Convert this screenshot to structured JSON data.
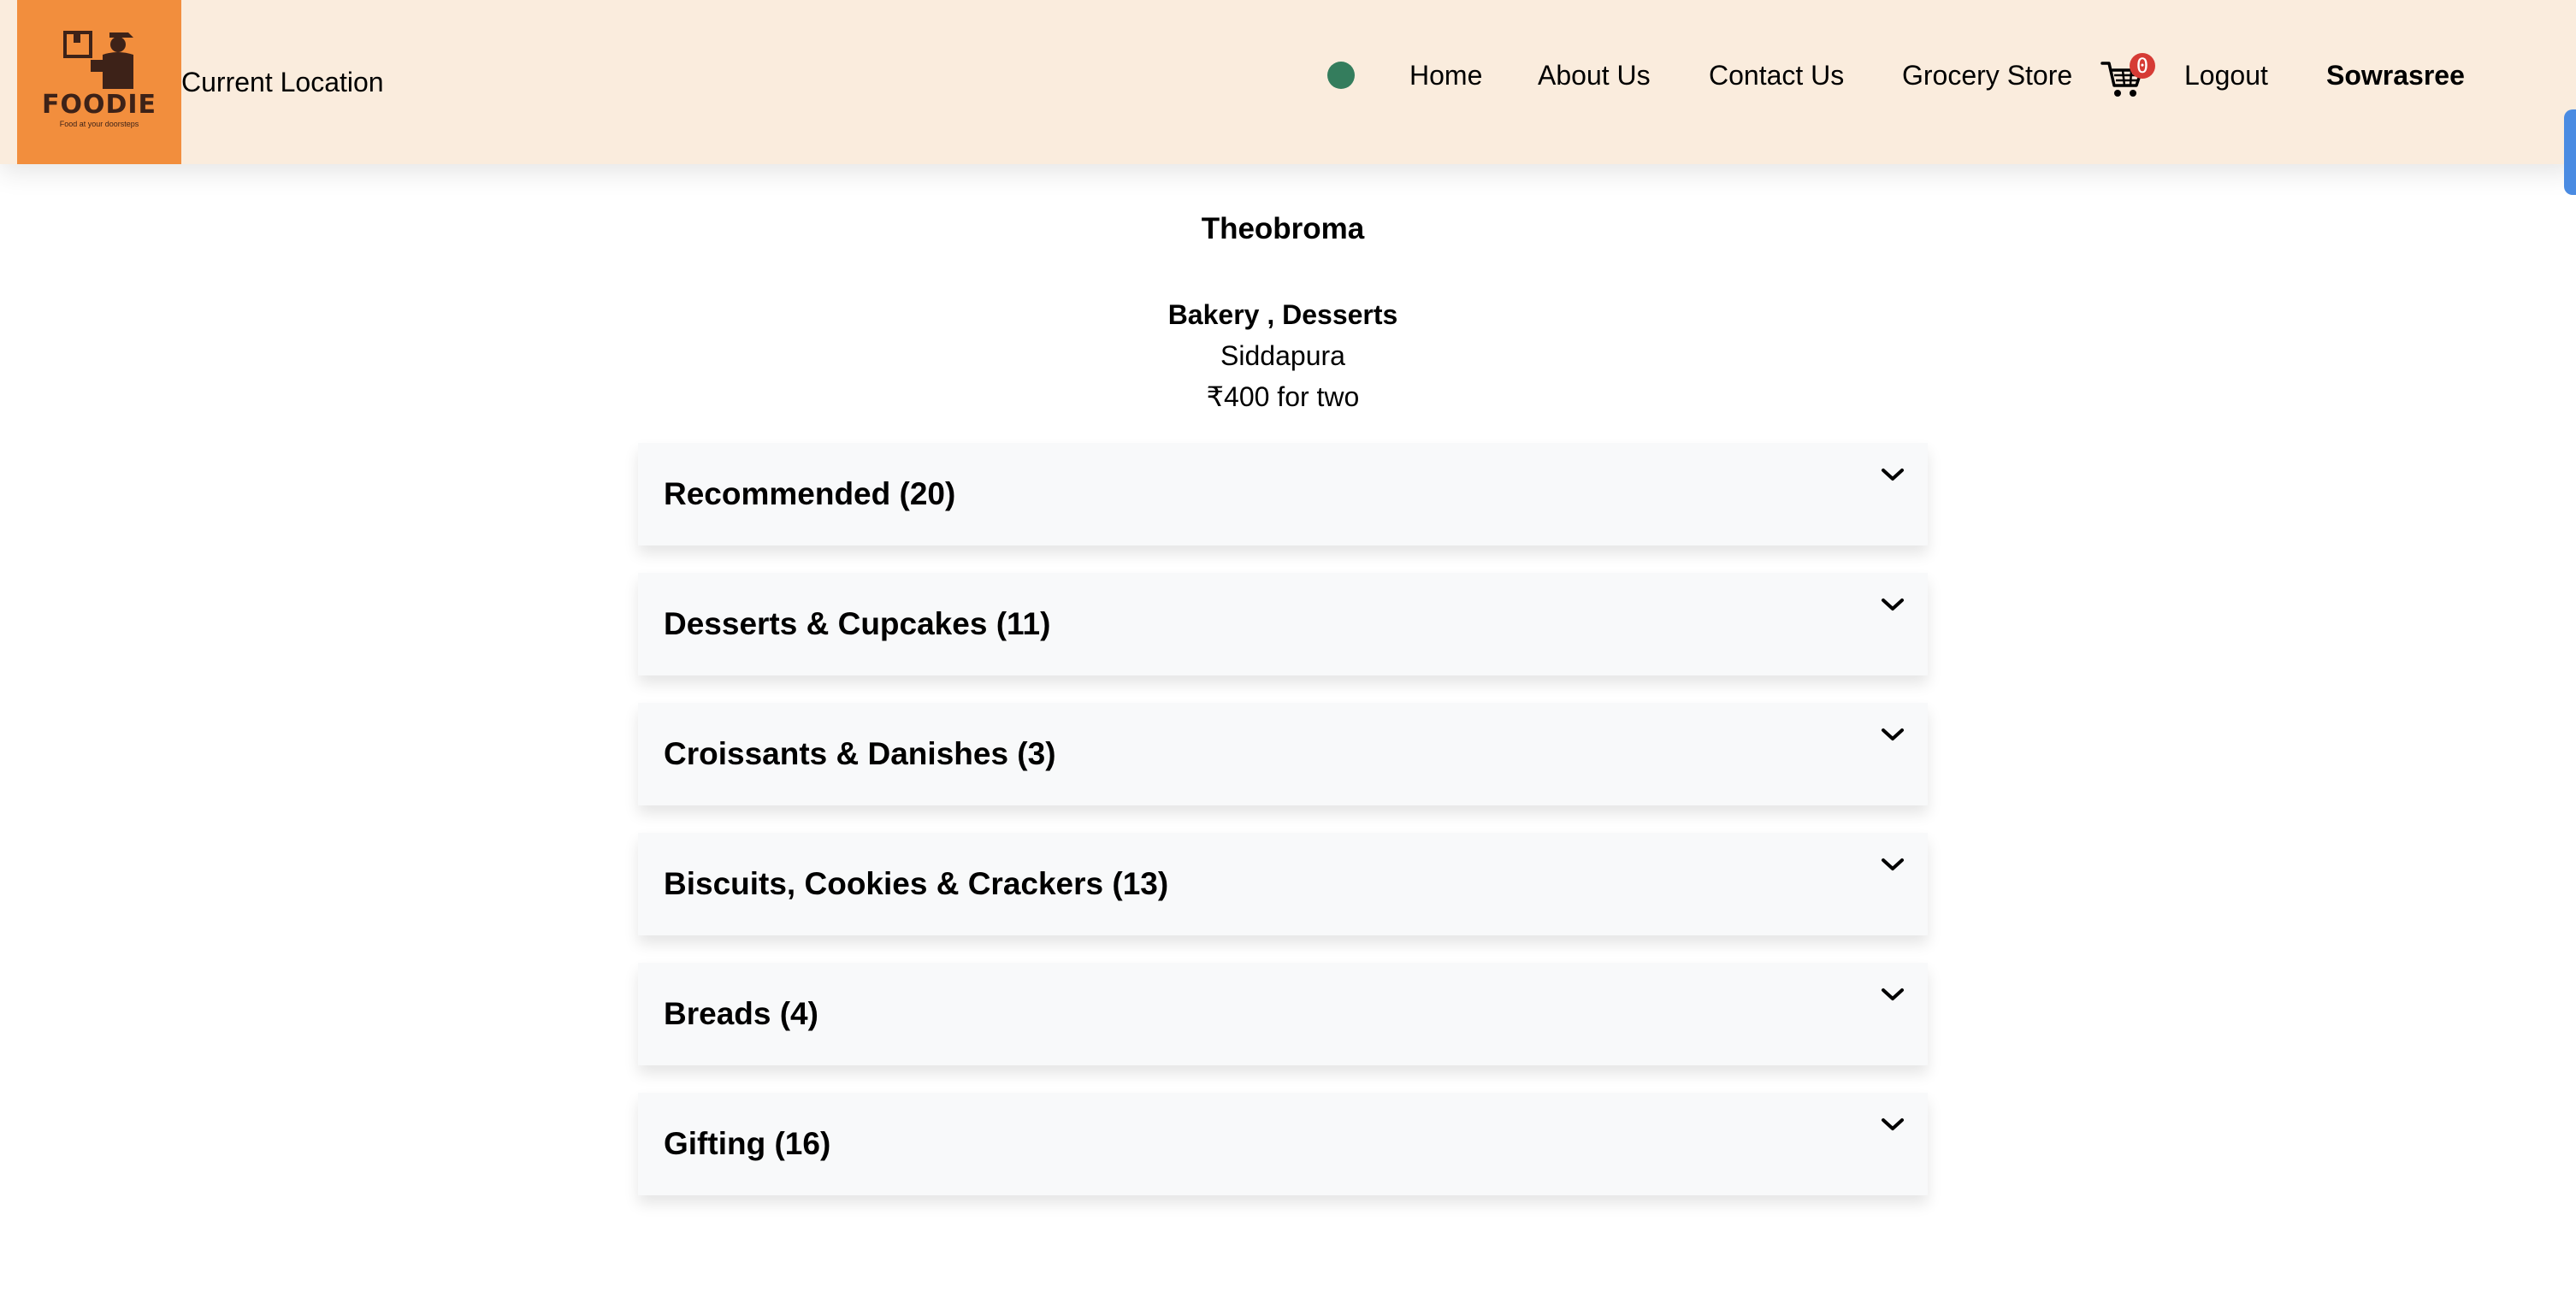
{
  "header": {
    "logo_word": "FOODIE",
    "logo_tagline": "Food at your doorsteps",
    "location_label": "Current Location",
    "nav": {
      "home": "Home",
      "about": "About Us",
      "contact": "Contact Us",
      "grocery": "Grocery Store",
      "logout": "Logout"
    },
    "cart_count": "0",
    "user_name": "Sowrasree",
    "colors": {
      "background": "#faecdd",
      "logo_bg": "#f28e3d",
      "online_dot": "#347d5d",
      "badge": "#d63b35"
    }
  },
  "restaurant": {
    "name": "Theobroma",
    "cuisines": "Bakery , Desserts",
    "area": "Siddapura",
    "cost_for_two": "₹400 for two"
  },
  "menu_sections": [
    {
      "title": "Recommended (20)",
      "icon": "chevron-down-icon"
    },
    {
      "title": "Desserts & Cupcakes (11)",
      "icon": "chevron-down-icon"
    },
    {
      "title": "Croissants & Danishes (3)",
      "icon": "chevron-down-icon"
    },
    {
      "title": "Biscuits, Cookies & Crackers (13)",
      "icon": "chevron-down-icon"
    },
    {
      "title": "Breads (4)",
      "icon": "chevron-down-icon"
    },
    {
      "title": "Gifting (16)",
      "icon": "chevron-down-icon"
    }
  ]
}
